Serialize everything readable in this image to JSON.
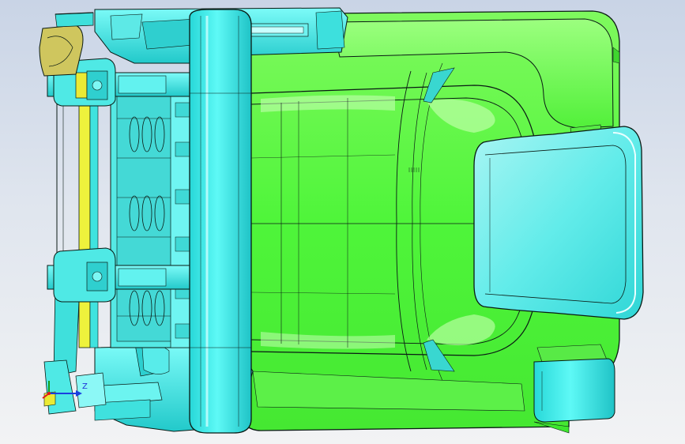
{
  "viewport": {
    "background_top": "#c9d4e6",
    "background_bottom": "#f2f3f4"
  },
  "colors": {
    "green_body": "#4ff53a",
    "green_highlight": "#a6ff8e",
    "green_dark": "#2fc81f",
    "cyan_part": "#2fe9e5",
    "cyan_light": "#b9ffff",
    "cyan_dark": "#12b5b8",
    "yellow_part": "#eeee34",
    "khaki_part": "#c8c25e",
    "edge": "#0a1a14"
  },
  "triad": {
    "axis_z_label": "Z",
    "axis_z_color": "#1a3fe0",
    "axis_y_color": "#e01818",
    "axis_x_color": "#18a018"
  }
}
